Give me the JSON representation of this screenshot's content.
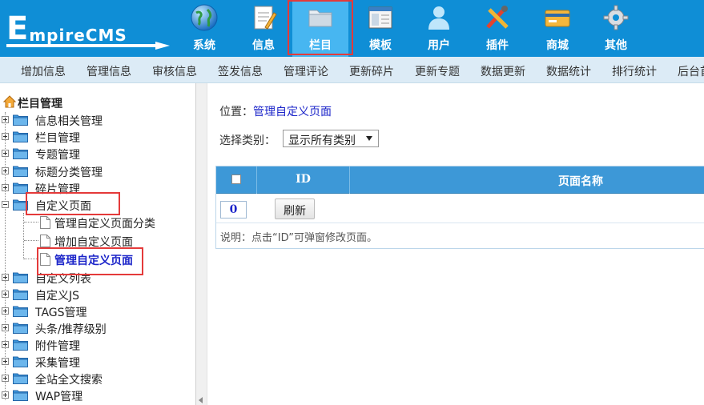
{
  "logo": {
    "big_letter": "E",
    "text": "mpireCMS"
  },
  "nav": [
    {
      "label": "系统",
      "icon": "globe-icon"
    },
    {
      "label": "信息",
      "icon": "notepad-icon"
    },
    {
      "label": "栏目",
      "icon": "folder-icon",
      "active": true
    },
    {
      "label": "模板",
      "icon": "window-icon"
    },
    {
      "label": "用户",
      "icon": "user-icon"
    },
    {
      "label": "插件",
      "icon": "tools-icon"
    },
    {
      "label": "商城",
      "icon": "credit-card-icon"
    },
    {
      "label": "其他",
      "icon": "gear-icon"
    }
  ],
  "subnav": [
    "增加信息",
    "管理信息",
    "审核信息",
    "签发信息",
    "管理评论",
    "更新碎片",
    "更新专题",
    "数据更新",
    "数据统计",
    "排行统计",
    "后台首"
  ],
  "sidebar": {
    "root_label": "栏目管理",
    "nodes": [
      "信息相关管理",
      "栏目管理",
      "专题管理",
      "标题分类管理",
      "碎片管理",
      "自定义页面",
      "自定义列表",
      "自定义JS",
      "TAGS管理",
      "头条/推荐级别",
      "附件管理",
      "采集管理",
      "全站全文搜索",
      "WAP管理"
    ],
    "leaves": [
      "管理自定义页面分类",
      "增加自定义页面",
      "管理自定义页面"
    ]
  },
  "main": {
    "breadcrumb_prefix": "位置：",
    "breadcrumb_link": "管理自定义页面",
    "filter_label": "选择类别：",
    "filter_value": "显示所有类别",
    "table": {
      "col_id": "ID",
      "col_name": "页面名称",
      "id_value": "0",
      "refresh_label": "刷新"
    },
    "note": "说明：点击“ID”可弹窗修改页面。"
  },
  "colors": {
    "header_bg": "#0f8ed6",
    "subnav_bg": "#dcebf6",
    "table_head": "#3d98d7",
    "highlight_red": "#e43a3a",
    "link_blue": "#1b24c9"
  }
}
